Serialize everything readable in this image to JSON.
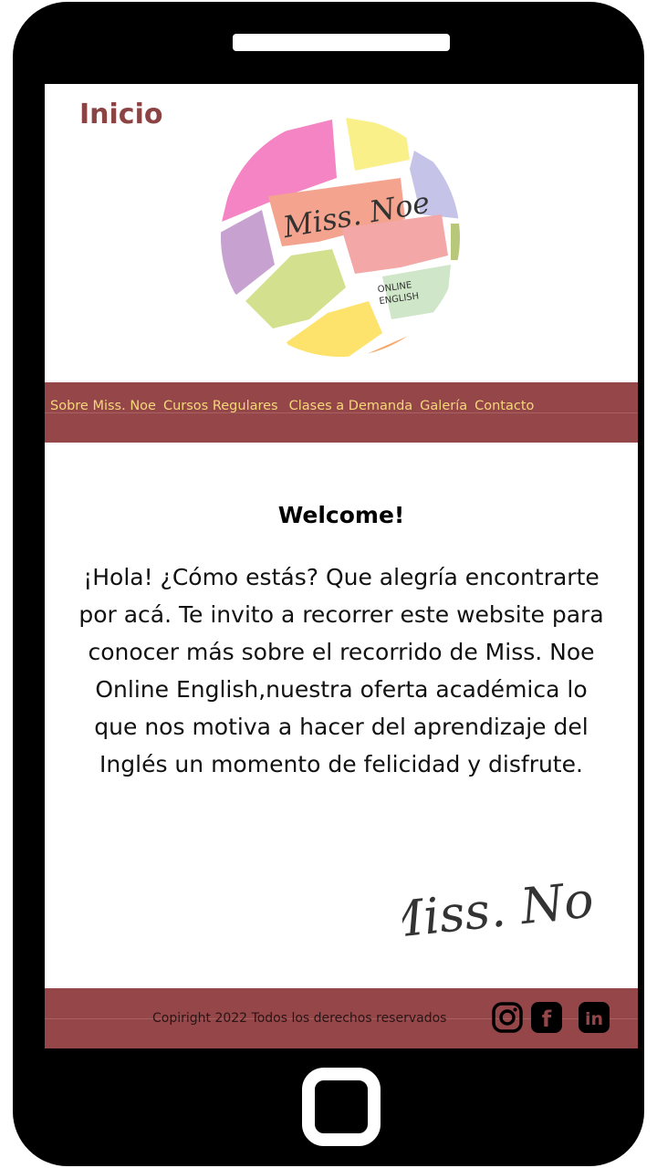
{
  "page": {
    "title": "Inicio"
  },
  "logo": {
    "brand_text": "Miss. Noe",
    "badge_line1": "ONLINE",
    "badge_line2": "ENGLISH"
  },
  "nav": {
    "items": [
      {
        "label": "Sobre Miss. Noe"
      },
      {
        "label": "Cursos Regulares"
      },
      {
        "label": "Clases a Demanda"
      },
      {
        "label": "Galería"
      },
      {
        "label": "Contacto"
      }
    ]
  },
  "main": {
    "heading": "Welcome!",
    "body": "¡Hola! ¿Cómo estás? Que alegría encontrarte por acá. Te invito a recorrer este website para conocer más sobre el recorrido de Miss. Noe Online English,nuestra oferta académica  lo que nos motiva a hacer del aprendizaje del Inglés un momento de felicidad y disfrute.",
    "signature": "Miss. Noe"
  },
  "footer": {
    "copyright": "Copiright 2022 Todos los derechos reservados",
    "social": [
      {
        "icon": "instagram-icon"
      },
      {
        "icon": "facebook-icon",
        "glyph": "f"
      },
      {
        "icon": "linkedin-icon",
        "glyph": "in"
      }
    ]
  },
  "colors": {
    "brand": "#944649",
    "title": "#8b4343",
    "nav_text": "#f6d77a",
    "phone_frame": "#000000"
  }
}
